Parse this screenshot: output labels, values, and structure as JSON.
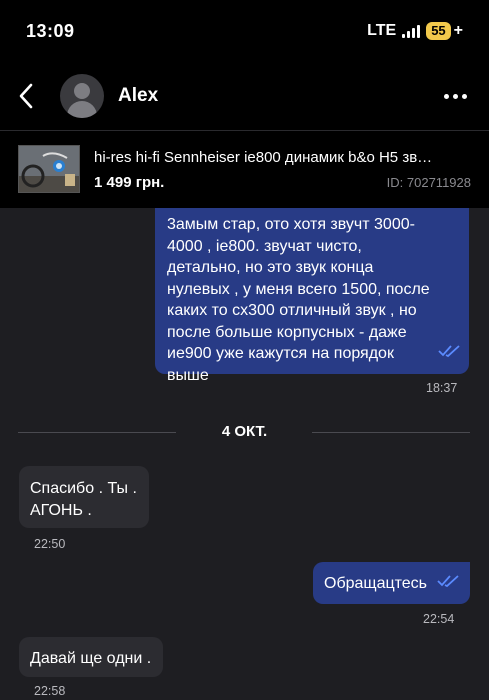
{
  "status": {
    "time": "13:09",
    "network": "LTE",
    "battery": "55",
    "battery_suffix": "+"
  },
  "header": {
    "contact_name": "Alex",
    "back_icon": "chevron-left-icon",
    "more_icon": "more-dots-icon"
  },
  "listing": {
    "title": "hi-res hi-fi   Sennheiser ie800  динамик b&o H5 зв…",
    "price": "1 499 грн.",
    "id_label": "ID: 702711928"
  },
  "messages": [
    {
      "direction": "out",
      "text": "3амым стар, ото хотя звучт 3000-4000 , ie800. звучат чисто, детально, но это звук конца нулевых , у меня всего 1500, после каких то cx300 отличный звук , но после больше корпусных - даже ие900 уже кажутся на порядок выше",
      "time": "18:37",
      "read": true
    },
    {
      "direction": "in",
      "text": "Спасибо . Ты . АГОНЬ .",
      "time": "22:50"
    },
    {
      "direction": "out",
      "text": "Обращацтесь",
      "time": "22:54",
      "read": true
    },
    {
      "direction": "in",
      "text": "Давай ще одни .",
      "time": "22:58"
    }
  ],
  "date_separator": "4 ОКТ.",
  "colors": {
    "outgoing": "#283b86",
    "incoming": "#2c2c31",
    "background": "#1e1e22",
    "check": "#5b8bff"
  }
}
